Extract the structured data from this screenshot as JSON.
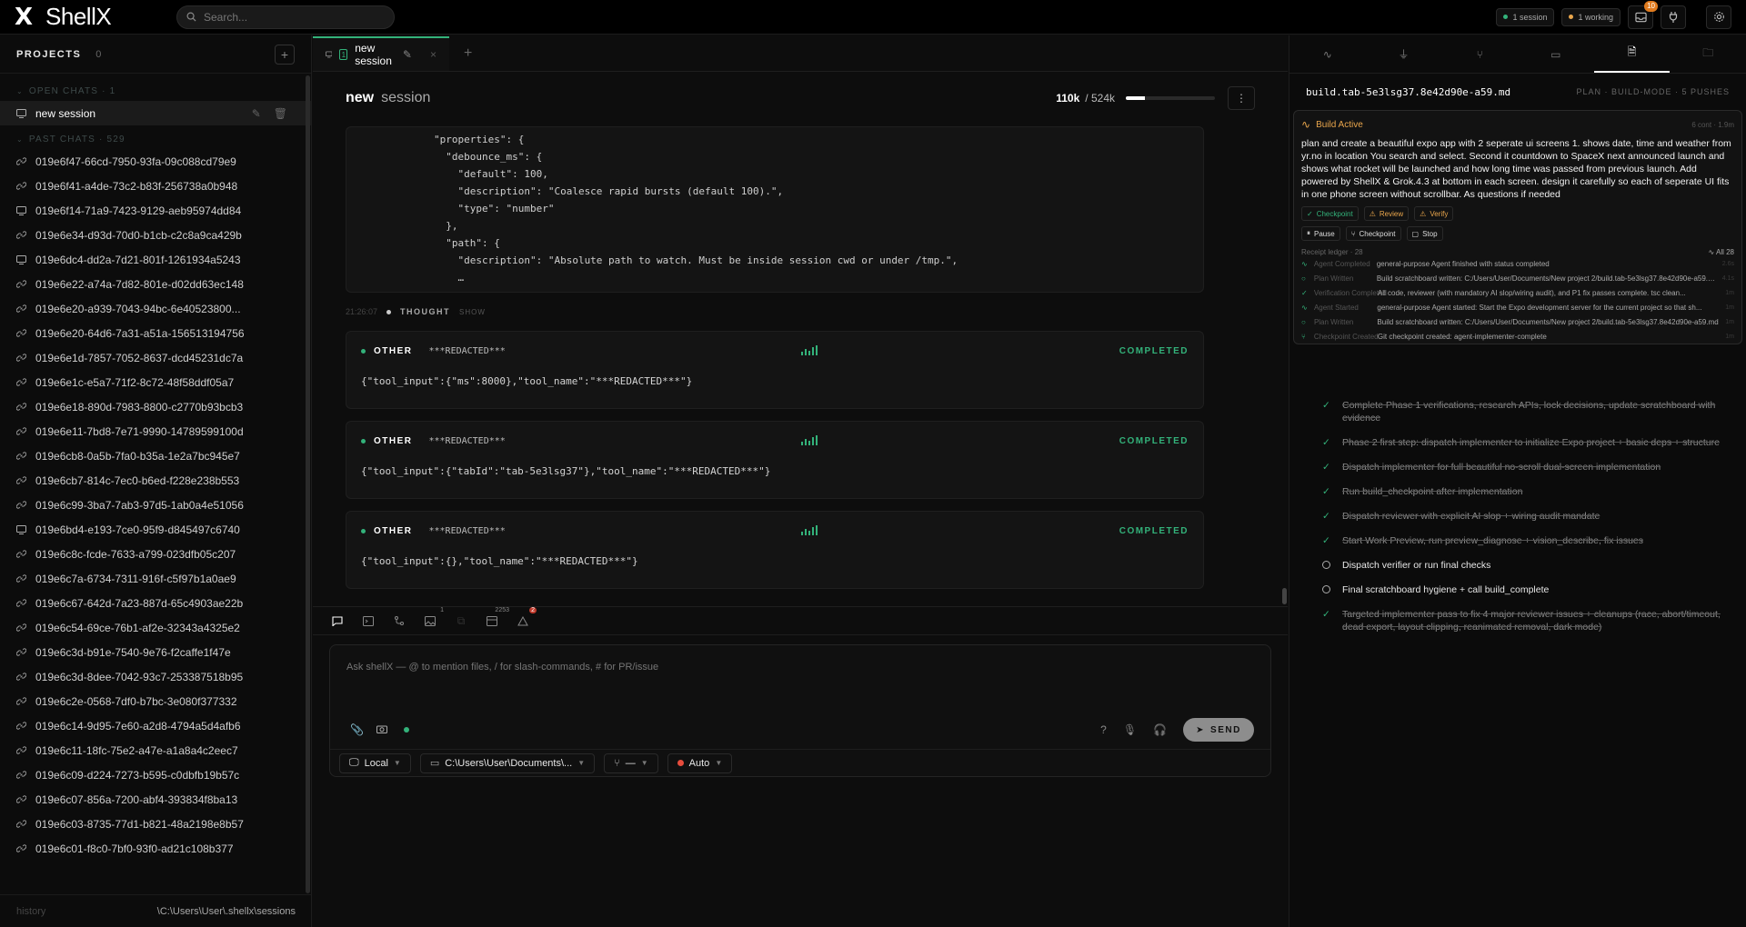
{
  "app": {
    "name": "ShellX",
    "logo_glyph": "X"
  },
  "search": {
    "placeholder": "Search..."
  },
  "top": {
    "sessions": "1 session",
    "working": "1 working",
    "notif_count": "10"
  },
  "sidebar": {
    "projects_title": "PROJECTS",
    "projects_count": "0",
    "open_label": "OPEN CHATS · 1",
    "active_chat": "new session",
    "past_label": "PAST CHATS · 529",
    "past_chats": [
      {
        "id": "019e6f47-66cd-7950-93fa-09c088cd79e9",
        "icon": "link"
      },
      {
        "id": "019e6f41-a4de-73c2-b83f-256738a0b948",
        "icon": "link"
      },
      {
        "id": "019e6f14-71a9-7423-9129-aeb95974dd84",
        "icon": "monitor"
      },
      {
        "id": "019e6e34-d93d-70d0-b1cb-c2c8a9ca429b",
        "icon": "link"
      },
      {
        "id": "019e6dc4-dd2a-7d21-801f-1261934a5243",
        "icon": "monitor"
      },
      {
        "id": "019e6e22-a74a-7d82-801e-d02dd63ec148",
        "icon": "link"
      },
      {
        "id": "019e6e20-a939-7043-94bc-6e40523800...",
        "icon": "link"
      },
      {
        "id": "019e6e20-64d6-7a31-a51a-156513194756",
        "icon": "link"
      },
      {
        "id": "019e6e1d-7857-7052-8637-dcd45231dc7a",
        "icon": "link"
      },
      {
        "id": "019e6e1c-e5a7-71f2-8c72-48f58ddf05a7",
        "icon": "link"
      },
      {
        "id": "019e6e18-890d-7983-8800-c2770b93bcb3",
        "icon": "link"
      },
      {
        "id": "019e6e11-7bd8-7e71-9990-14789599100d",
        "icon": "link"
      },
      {
        "id": "019e6cb8-0a5b-7fa0-b35a-1e2a7bc945e7",
        "icon": "link"
      },
      {
        "id": "019e6cb7-814c-7ec0-b6ed-f228e238b553",
        "icon": "link"
      },
      {
        "id": "019e6c99-3ba7-7ab3-97d5-1ab0a4e51056",
        "icon": "link"
      },
      {
        "id": "019e6bd4-e193-7ce0-95f9-d845497c6740",
        "icon": "monitor"
      },
      {
        "id": "019e6c8c-fcde-7633-a799-023dfb05c207",
        "icon": "link"
      },
      {
        "id": "019e6c7a-6734-7311-916f-c5f97b1a0ae9",
        "icon": "link"
      },
      {
        "id": "019e6c67-642d-7a23-887d-65c4903ae22b",
        "icon": "link"
      },
      {
        "id": "019e6c54-69ce-76b1-af2e-32343a4325e2",
        "icon": "link"
      },
      {
        "id": "019e6c3d-b91e-7540-9e76-f2caffe1f47e",
        "icon": "link"
      },
      {
        "id": "019e6c3d-8dee-7042-93c7-253387518b95",
        "icon": "link"
      },
      {
        "id": "019e6c2e-0568-7df0-b7bc-3e080f377332",
        "icon": "link"
      },
      {
        "id": "019e6c14-9d95-7e60-a2d8-4794a5d4afb6",
        "icon": "link"
      },
      {
        "id": "019e6c11-18fc-75e2-a47e-a1a8a4c2eec7",
        "icon": "link"
      },
      {
        "id": "019e6c09-d224-7273-b595-c0dbfb19b57c",
        "icon": "link"
      },
      {
        "id": "019e6c07-856a-7200-abf4-393834f8ba13",
        "icon": "link"
      },
      {
        "id": "019e6c03-8735-77d1-b821-48a2198e8b57",
        "icon": "link"
      },
      {
        "id": "019e6c01-f8c0-7bf0-93f0-ad21c108b377",
        "icon": "link"
      }
    ],
    "footer_left": "history",
    "footer_right": "\\C:\\Users\\User\\.shellx\\sessions"
  },
  "main": {
    "tab": {
      "num": "1",
      "label": "new session"
    },
    "title_bold": "new",
    "title_rest": "session",
    "tokens_used": "110k",
    "tokens_total": "/ 524k",
    "token_fraction": 0.21,
    "code_lines": [
      "\"properties\": {",
      "  \"debounce_ms\": {",
      "    \"default\": 100,",
      "    \"description\": \"Coalesce rapid bursts (default 100).\",",
      "    \"type\": \"number\"",
      "  },",
      "  \"path\": {",
      "    \"description\": \"Absolute path to watch. Must be inside session cwd or under /tmp.\",",
      "    …"
    ],
    "thought": {
      "time": "21:26:07",
      "label": "THOUGHT",
      "show": "SHOW"
    },
    "tool_cards": [
      {
        "kind": "OTHER",
        "name": "***REDACTED***",
        "status": "COMPLETED",
        "body": "{\"tool_input\":{\"ms\":8000},\"tool_name\":\"***REDACTED***\"}"
      },
      {
        "kind": "OTHER",
        "name": "***REDACTED***",
        "status": "COMPLETED",
        "body": "{\"tool_input\":{\"tabId\":\"tab-5e3lsg37\"},\"tool_name\":\"***REDACTED***\"}"
      },
      {
        "kind": "OTHER",
        "name": "***REDACTED***",
        "status": "COMPLETED",
        "body": "{\"tool_input\":{},\"tool_name\":\"***REDACTED***\"}"
      }
    ],
    "strip": {
      "img_count": "1",
      "tokens": "2253",
      "warn_count": "2"
    },
    "composer": {
      "placeholder": "Ask shellX — @ to mention files, / for slash-commands, # for PR/issue",
      "help": "?",
      "send": "SEND",
      "env": "Local",
      "cwd": "C:\\Users\\User\\Documents\\...",
      "branch": "—",
      "mode": "Auto"
    }
  },
  "right": {
    "file": "build.tab-5e3lsg37.8e42d90e-a59.md",
    "meta": "PLAN · BUILD-MODE · 5 PUSHES",
    "build_title": "Build Active",
    "build_meta": "6 cont · 1.9m",
    "build_desc": "plan and create a beautiful expo app with 2 seperate ui screens 1. shows date, time and weather from yr.no in location You search and select. Second it countdown to SpaceX next announced launch and shows what rocket will be launched and how long time was passed from previous launch. Add powered by ShellX & Grok.4.3 at bottom in each screen. design it carefully so each of seperate UI fits in one phone screen without scrollbar. As questions if needed",
    "chips": [
      "Checkpoint",
      "Review",
      "Verify"
    ],
    "actions": [
      "Pause",
      "Checkpoint",
      "Stop"
    ],
    "ledger_label": "Receipt ledger · 28",
    "ledger_all": "All 28",
    "ledger": [
      {
        "event": "Agent Completed",
        "text": "general-purpose Agent finished with status completed",
        "time": "2.6s",
        "icon": "pulse"
      },
      {
        "event": "Plan Written",
        "text": "Build scratchboard written: C:/Users/User/Documents/New project 2/build.tab-5e3lsg37.8e42d90e-a59.md",
        "time": "4.1s",
        "icon": "circle"
      },
      {
        "event": "Verification Completed",
        "text": "All code, reviewer (with mandatory AI slop/wiring audit), and P1 fix passes complete. tsc clean...",
        "time": "1m",
        "icon": "check"
      },
      {
        "event": "Agent Started",
        "text": "general-purpose Agent started: Start the Expo development server for the current project so that sh...",
        "time": "1m",
        "icon": "pulse"
      },
      {
        "event": "Plan Written",
        "text": "Build scratchboard written: C:/Users/User/Documents/New project 2/build.tab-5e3lsg37.8e42d90e-a59.md",
        "time": "1m",
        "icon": "circle"
      },
      {
        "event": "Checkpoint Created",
        "text": "Git checkpoint created: agent-implementer-complete",
        "time": "1m",
        "icon": "branch"
      }
    ],
    "checklist": [
      {
        "text": "Complete Phase 1 verifications, research APIs, lock decisions, update scratchboard with evidence",
        "done": true
      },
      {
        "text": "Phase 2 first step: dispatch implementer to initialize Expo project + basic deps + structure",
        "done": true
      },
      {
        "text": "Dispatch implementer for full beautiful no-scroll dual-screen implementation",
        "done": true
      },
      {
        "text": "Run build_checkpoint after implementation",
        "done": true
      },
      {
        "text": "Dispatch reviewer with explicit AI slop + wiring audit mandate",
        "done": true
      },
      {
        "text": "Start Work Preview, run preview_diagnose + vision_describe, fix issues",
        "done": true
      },
      {
        "text": "Dispatch verifier or run final checks",
        "done": false
      },
      {
        "text": "Final scratchboard hygiene + call build_complete",
        "done": false
      },
      {
        "text": "Targeted implementer pass to fix 4 major reviewer issues + cleanups (race, abort/timeout, dead export, layout clipping, reanimated removal, dark mode)",
        "done": true
      }
    ]
  },
  "colors": {
    "accent": "#33b27a",
    "warning": "#e9a64c",
    "error": "#e74c3c"
  }
}
